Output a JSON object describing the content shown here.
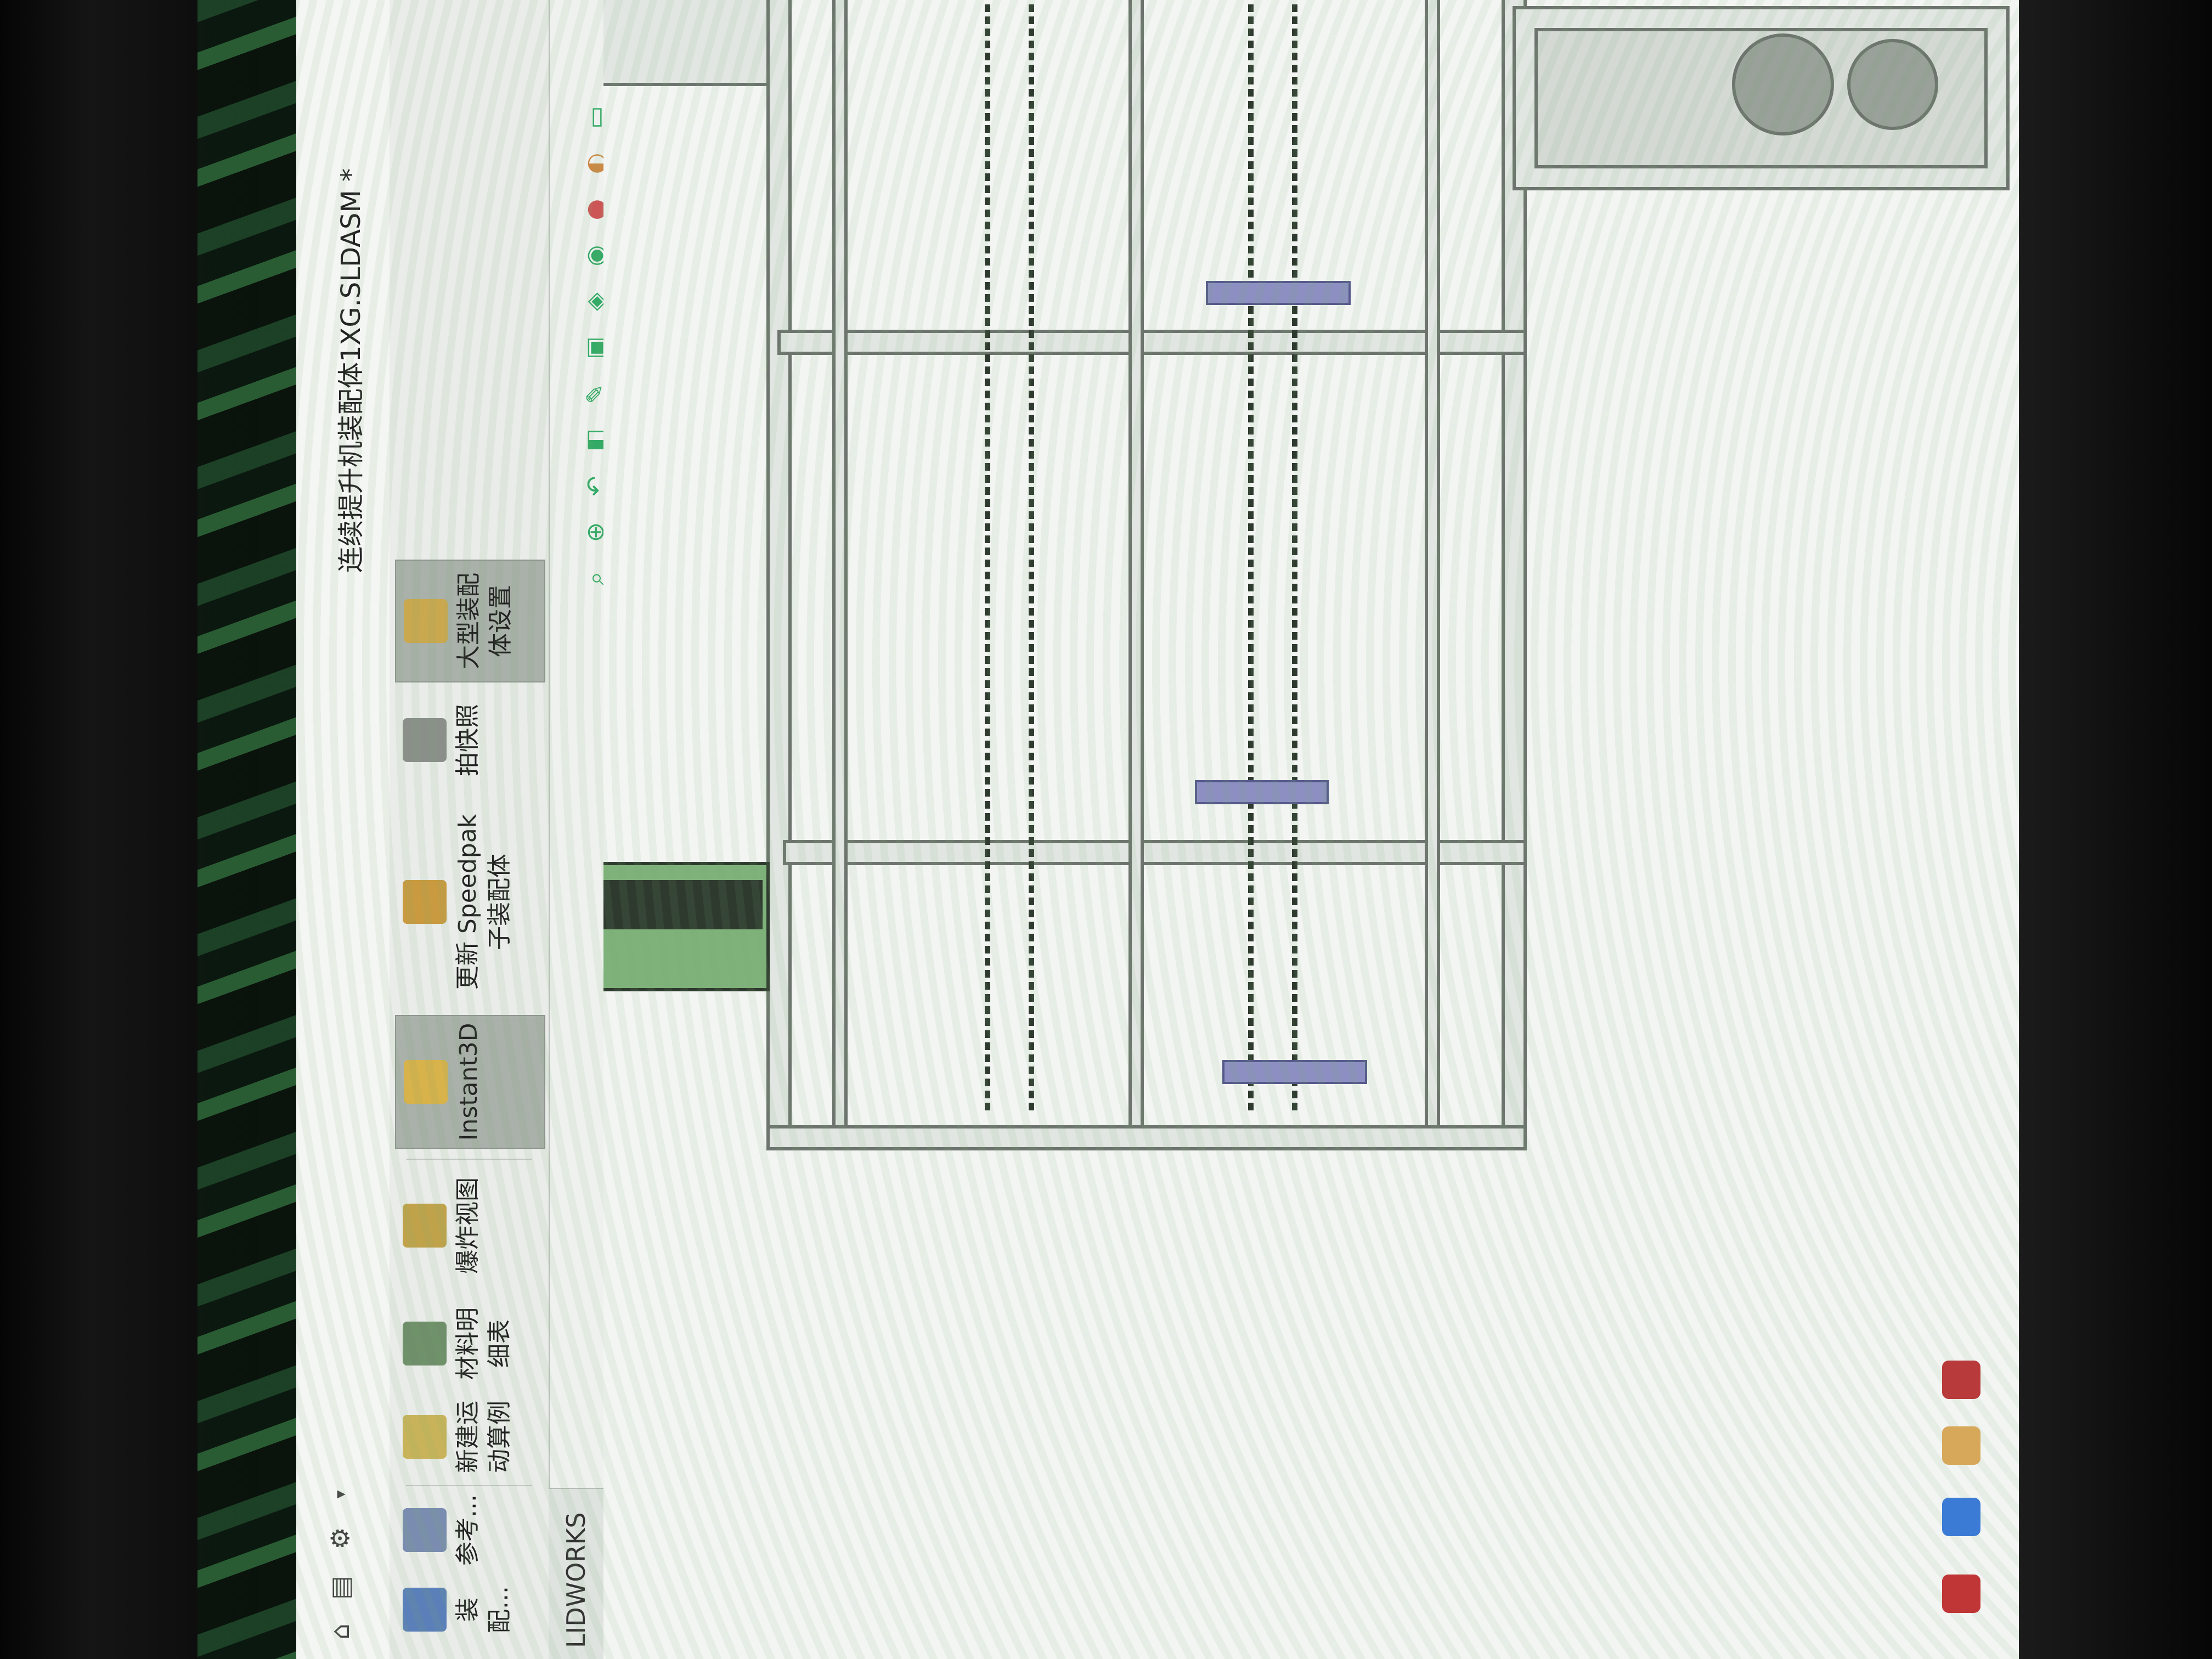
{
  "window": {
    "title": "连续提升机装配体1XG.SLDASM *"
  },
  "quick_access": {
    "icons": [
      "home-icon",
      "document-icon",
      "gear-icon",
      "dropdown-arrow"
    ]
  },
  "ribbon": {
    "buttons": [
      {
        "label": "装配...",
        "icon": "assembly-icon"
      },
      {
        "label": "参考...",
        "icon": "reference-icon"
      },
      {
        "label": "新建运\n动算例",
        "icon": "motion-study-icon"
      },
      {
        "label": "材料明\n细表",
        "icon": "bom-icon"
      },
      {
        "label": "爆炸视图",
        "icon": "exploded-view-icon"
      },
      {
        "label": "Instant3D",
        "icon": "instant3d-icon"
      },
      {
        "label": "更新 Speedpak\n子装配体",
        "icon": "speedpak-icon"
      },
      {
        "label": "拍快照",
        "icon": "snapshot-icon"
      },
      {
        "label": "大型装配\n体设置",
        "icon": "large-assembly-icon"
      }
    ]
  },
  "tabs": {
    "cam": "LIDWORKS CAM"
  },
  "view_toolbar": {
    "icons": [
      "zoom-fit-icon",
      "zoom-area-icon",
      "previous-view-icon",
      "section-view-icon",
      "dynamic-annotation-icon",
      "view-orientation-icon",
      "display-style-icon",
      "hide-show-icon",
      "edit-appearance-icon",
      "scene-icon",
      "view-settings-icon",
      "monitor-icon"
    ]
  },
  "colors": {
    "active_button": "#aab0aa",
    "frame": "#e2e6e2",
    "frame_edge": "#6d746d",
    "chain": "#2f3a2f",
    "belt_green": "#7fb27a",
    "guard_blue": "#8d8fc2"
  }
}
